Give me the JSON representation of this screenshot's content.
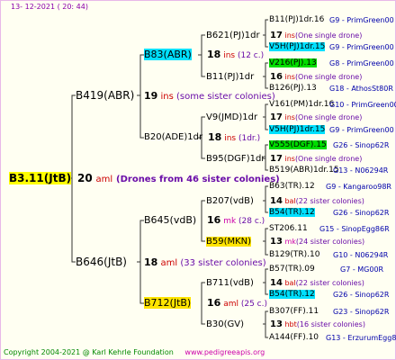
{
  "date": "13- 12-2021 ( 20: 44)",
  "root": {
    "name": "B3.11(JtB)",
    "count": "20",
    "suffix": "aml",
    "note": "(Drones from 46 sister colonies)"
  },
  "gen1": [
    {
      "name": "B419(ABR)",
      "count": "19",
      "suffix": "ins",
      "note": "(some sister colonies)"
    },
    {
      "name": "B646(JtB)",
      "count": "18",
      "suffix": "aml",
      "note": "(33 sister colonies)"
    }
  ],
  "gen2": [
    {
      "name": "B83(ABR)",
      "count": "18",
      "suffix": "ins",
      "note": "(12 c.)"
    },
    {
      "name": "B20(ADE)1dr",
      "count": "18",
      "suffix": "ins",
      "note": "(1dr.)"
    },
    {
      "name": "B645(vdB)",
      "count": "16",
      "suffix": "mk",
      "note": "(28 c.)"
    },
    {
      "name": "B712(JtB)",
      "count": "16",
      "suffix": "aml",
      "note": "(25 c.)"
    }
  ],
  "gen3": [
    {
      "name": "B621(PJ)1dr",
      "count": "17",
      "suffix": "ins",
      "note": "(One single drone)"
    },
    {
      "name": "B11(PJ)1dr",
      "count": "16",
      "suffix": "ins",
      "note": "(One single drone)"
    },
    {
      "name": "V9(JMD)1dr",
      "count": "17",
      "suffix": "ins",
      "note": "(One single drone)"
    },
    {
      "name": "B95(DGF)1dr",
      "count": "17",
      "suffix": "ins",
      "note": "(One single drone)"
    },
    {
      "name": "B207(vdB)",
      "count": "14",
      "suffix": "bal",
      "note": "(22 sister colonies)"
    },
    {
      "name": "B59(MKN)",
      "count": "13",
      "suffix": "mk",
      "note": "(24 sister colonies)"
    },
    {
      "name": "B711(vdB)",
      "count": "14",
      "suffix": "bal",
      "note": "(22 sister colonies)"
    },
    {
      "name": "B30(GV)",
      "count": "13",
      "suffix": "hbt",
      "note": "(16 sister colonies)"
    }
  ],
  "gen4": [
    {
      "name": "B11(PJ)1dr.16",
      "ref": "G9 - PrimGreen00"
    },
    {
      "name": "V5H(PJ)1dr.15",
      "ref": "G9 - PrimGreen00"
    },
    {
      "name": "V216(PJ).13",
      "ref": "G8 - PrimGreen00"
    },
    {
      "name": "B126(PJ).13",
      "ref": "G18 - AthosSt80R"
    },
    {
      "name": "V161(PM)1dr.16",
      "ref": "G10 - PrimGreen00"
    },
    {
      "name": "V5H(PJ)1dr.15",
      "ref": "G9 - PrimGreen00"
    },
    {
      "name": "V555(DGF).15",
      "ref": "G26 - Sinop62R"
    },
    {
      "name": "B519(ABR)1dr.15",
      "ref": "G13 - N06294R"
    },
    {
      "name": "B63(TR).12",
      "ref": "G9 - Kangaroo98R"
    },
    {
      "name": "B54(TR).12",
      "ref": "G26 - Sinop62R"
    },
    {
      "name": "ST206.11",
      "ref": "G15 - SinopEgg86R"
    },
    {
      "name": "B129(TR).10",
      "ref": "G10 - N06294R"
    },
    {
      "name": "B57(TR).09",
      "ref": "G7 - MG00R"
    },
    {
      "name": "B54(TR).12",
      "ref": "G26 - Sinop62R"
    },
    {
      "name": "B307(FF).11",
      "ref": "G23 - Sinop62R"
    },
    {
      "name": "A144(FF).10",
      "ref": "G13 - ErzurumEgg8"
    }
  ],
  "footer": {
    "copyright": "Copyright 2004-2021 @ Karl Kehrle Foundation",
    "site": "www.pedigreeapis.org"
  }
}
